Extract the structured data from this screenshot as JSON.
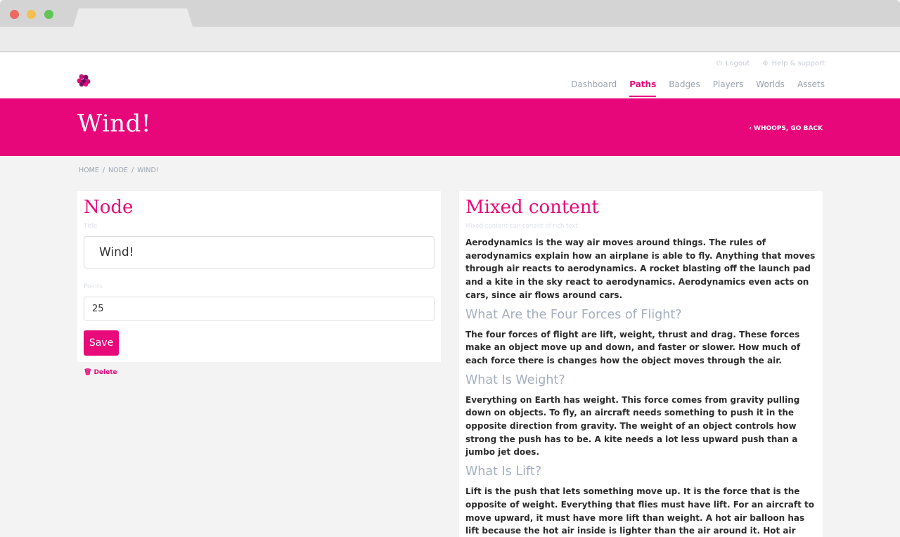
{
  "header": {
    "util_links": [
      {
        "label": "Logout",
        "icon": "power-icon"
      },
      {
        "label": "Help & support",
        "icon": "lifebuoy-icon"
      }
    ],
    "nav": [
      {
        "label": "Dashboard",
        "active": false
      },
      {
        "label": "Paths",
        "active": true
      },
      {
        "label": "Badges",
        "active": false
      },
      {
        "label": "Players",
        "active": false
      },
      {
        "label": "Worlds",
        "active": false
      },
      {
        "label": "Assets",
        "active": false
      }
    ]
  },
  "hero": {
    "title": "Wind!",
    "back_label": "WHOOPS, GO BACK"
  },
  "breadcrumb": [
    "HOME",
    "NODE",
    "WIND!"
  ],
  "breadcrumb_separator": "/",
  "node_form": {
    "heading": "Node",
    "title_label": "Title",
    "title_value": "Wind!",
    "points_label": "Points",
    "points_value": "25",
    "save_label": "Save",
    "delete_label": "Delete"
  },
  "mixed_content": {
    "heading": "Mixed content",
    "subtext": "Mixed content can consist of rich text",
    "lead": "Aerodynamics is the way air moves around things. The rules of aerodynamics explain how an airplane is able to fly. Anything that moves through air reacts to aerodynamics. A rocket blasting off the launch pad and a kite in the sky react to aerodynamics. Aerodynamics even acts on cars, since air flows around cars.",
    "sections": [
      {
        "heading": "What Are the Four Forces of Flight?",
        "body": "The four forces of flight are lift, weight, thrust and drag. These forces make an object move up and down, and faster or slower. How much of each force there is changes how the object moves through the air."
      },
      {
        "heading": "What Is Weight?",
        "body": "Everything on Earth has weight. This force comes from gravity pulling down on objects. To fly, an aircraft needs something to push it in the opposite direction from gravity. The weight of an object controls how strong the push has to be. A kite needs a lot less upward push than a jumbo jet does."
      },
      {
        "heading": "What Is Lift?",
        "body": "Lift is the push that lets something move up. It is the force that is the opposite of weight. Everything that flies must have lift. For an aircraft to move upward, it must have more lift than weight. A hot air balloon has lift because the hot air inside is lighter than the air around it. Hot air rises and carries the balloon with it. A"
      }
    ]
  },
  "colors": {
    "accent": "#e8077a",
    "muted": "#9aa3b0",
    "subheading": "#a5aebe"
  }
}
